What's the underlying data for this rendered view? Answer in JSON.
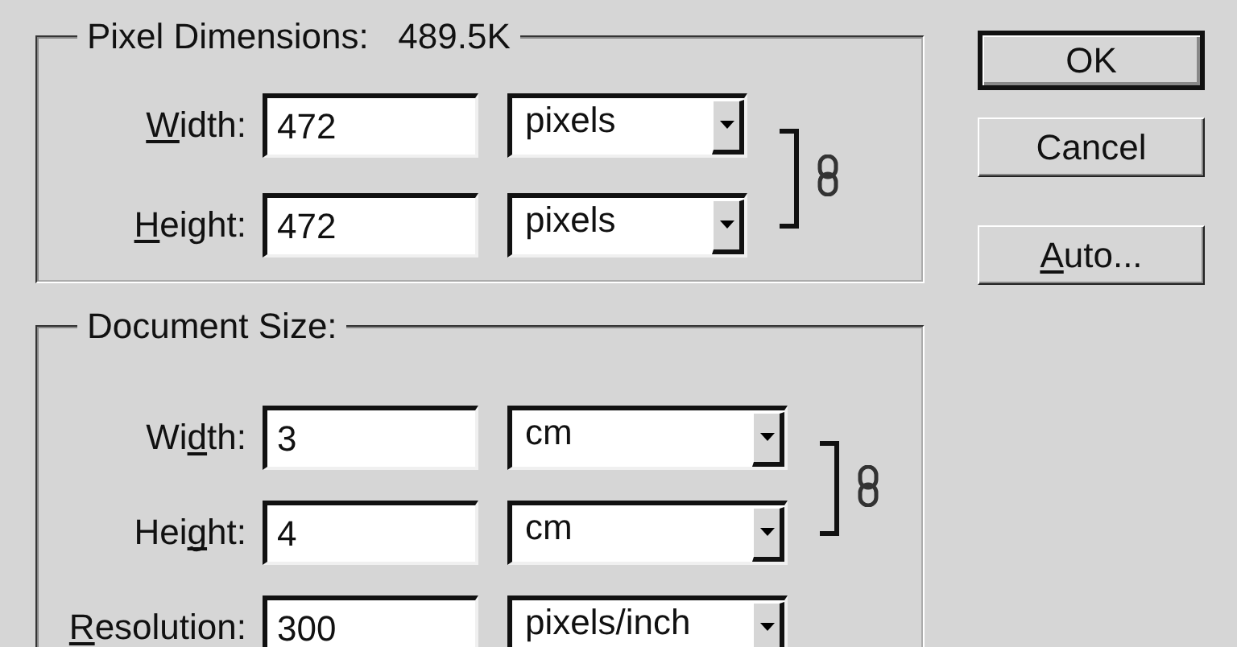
{
  "groups": [
    {
      "title": "Pixel Dimensions:",
      "size": "489.5K",
      "linked": true,
      "rows": [
        {
          "label": [
            {
              "text": "W",
              "underline": true
            },
            {
              "text": "idth:",
              "underline": false
            }
          ],
          "value": "472",
          "unit": "pixels"
        },
        {
          "label": [
            {
              "text": "H",
              "underline": true
            },
            {
              "text": "eight:",
              "underline": false
            }
          ],
          "value": "472",
          "unit": "pixels"
        }
      ]
    },
    {
      "title": "Document Size:",
      "linked": true,
      "rows": [
        {
          "label": [
            {
              "text": "Wi",
              "underline": false
            },
            {
              "text": "d",
              "underline": true
            },
            {
              "text": "th:",
              "underline": false
            }
          ],
          "value": "3",
          "unit": "cm"
        },
        {
          "label": [
            {
              "text": "Hei",
              "underline": false
            },
            {
              "text": "g",
              "underline": true
            },
            {
              "text": "ht:",
              "underline": false
            }
          ],
          "value": "4",
          "unit": "cm"
        },
        {
          "label": [
            {
              "text": "R",
              "underline": true
            },
            {
              "text": "esolution:",
              "underline": false
            }
          ],
          "value": "300",
          "unit": "pixels/inch"
        }
      ]
    }
  ],
  "buttons": [
    {
      "label": [
        {
          "text": "OK",
          "underline": false
        }
      ],
      "default": true
    },
    {
      "label": [
        {
          "text": "Cancel",
          "underline": false
        }
      ],
      "default": false
    },
    {
      "label": [
        {
          "text": "A",
          "underline": true
        },
        {
          "text": "uto...",
          "underline": false
        }
      ],
      "default": false
    }
  ]
}
